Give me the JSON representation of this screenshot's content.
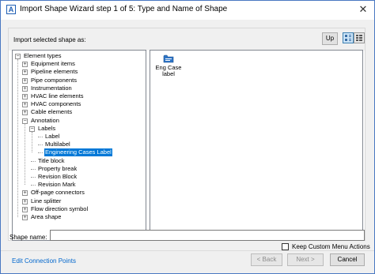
{
  "window": {
    "title": "Import Shape Wizard step 1 of 5: Type and Name of Shape",
    "app_icon_glyph": "A",
    "close_glyph": "✕"
  },
  "panel": {
    "import_label": "Import selected shape as:",
    "up_button": "Up"
  },
  "tree": {
    "items": [
      {
        "label": "Element types",
        "level": 0,
        "toggle": "−"
      },
      {
        "label": "Equipment items",
        "level": 1,
        "toggle": "+"
      },
      {
        "label": "Pipeline elements",
        "level": 1,
        "toggle": "+"
      },
      {
        "label": "Pipe components",
        "level": 1,
        "toggle": "+"
      },
      {
        "label": "Instrumentation",
        "level": 1,
        "toggle": "+"
      },
      {
        "label": "HVAC line elements",
        "level": 1,
        "toggle": "+"
      },
      {
        "label": "HVAC components",
        "level": 1,
        "toggle": "+"
      },
      {
        "label": "Cable elements",
        "level": 1,
        "toggle": "+"
      },
      {
        "label": "Annotation",
        "level": 1,
        "toggle": "−"
      },
      {
        "label": "Labels",
        "level": 2,
        "toggle": "−"
      },
      {
        "label": "Label",
        "level": 3,
        "toggle": ""
      },
      {
        "label": "Multilabel",
        "level": 3,
        "toggle": ""
      },
      {
        "label": "Engineering Cases Label",
        "level": 3,
        "toggle": "",
        "selected": true
      },
      {
        "label": "Title block",
        "level": 2,
        "toggle": ""
      },
      {
        "label": "Property break",
        "level": 2,
        "toggle": ""
      },
      {
        "label": "Revision Block",
        "level": 2,
        "toggle": ""
      },
      {
        "label": "Revision Mark",
        "level": 2,
        "toggle": ""
      },
      {
        "label": "Off-page connectors",
        "level": 1,
        "toggle": "+"
      },
      {
        "label": "Line splitter",
        "level": 1,
        "toggle": "+"
      },
      {
        "label": "Flow direction symbol",
        "level": 1,
        "toggle": "+"
      },
      {
        "label": "Area shape",
        "level": 1,
        "toggle": "+"
      }
    ]
  },
  "shapes": [
    {
      "label": "Eng Case label",
      "icon": "folder-label-icon"
    }
  ],
  "form": {
    "shape_name_label": "Shape name:",
    "shape_name_value": "",
    "keep_custom_label": "Keep Custom Menu Actions",
    "keep_custom_checked": false
  },
  "footer": {
    "edit_link": "Edit Connection Points",
    "back_label": "< Back",
    "next_label": "Next >",
    "cancel_label": "Cancel"
  },
  "colors": {
    "selection": "#0078d7",
    "link": "#0066cc",
    "accent": "#1f5fb4"
  }
}
